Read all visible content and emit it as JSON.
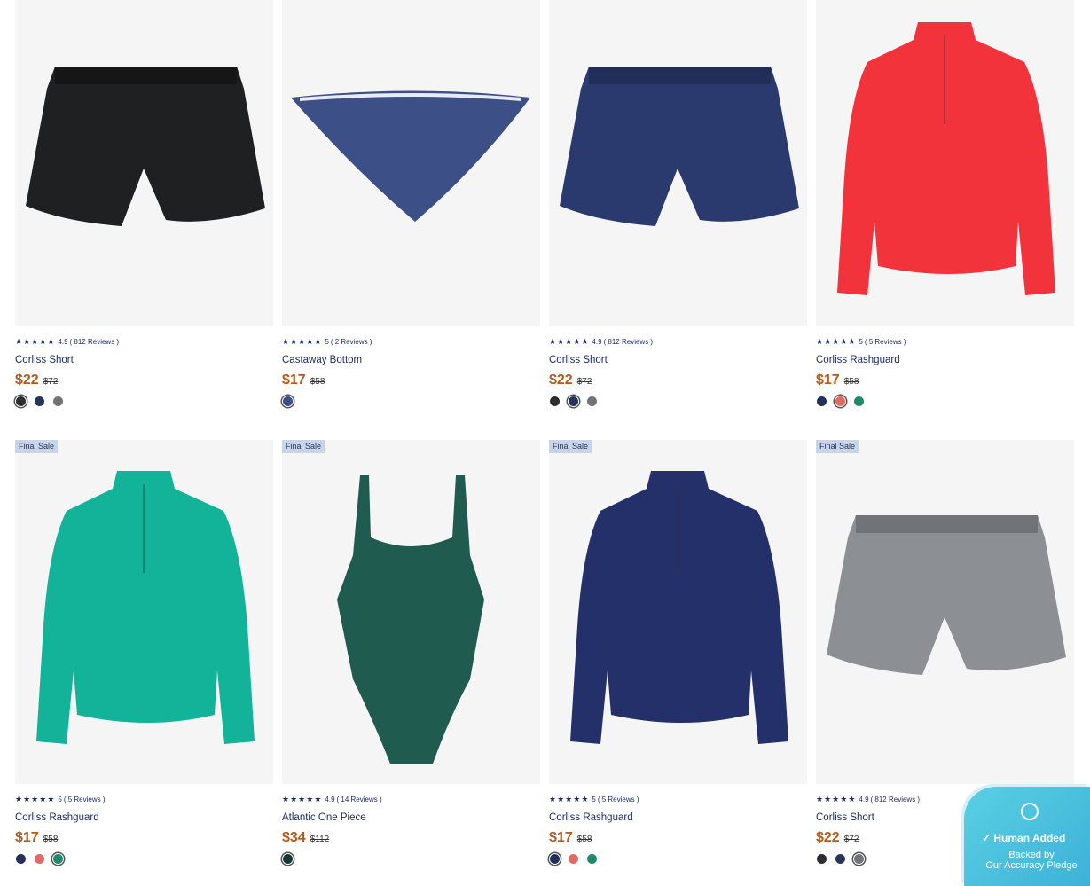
{
  "products": [
    {
      "badge": "",
      "rating": "4.9",
      "reviews": "( 812 Reviews )",
      "title": "Corliss Short",
      "price": "$22",
      "old": "$72",
      "swatches": [
        {
          "c": "#2b2d30",
          "sel": true
        },
        {
          "c": "#27355a",
          "sel": false
        },
        {
          "c": "#717476",
          "sel": false
        }
      ],
      "img": "shorts-black"
    },
    {
      "badge": "",
      "rating": "5",
      "reviews": "( 2 Reviews )",
      "title": "Castaway Bottom",
      "price": "$17",
      "old": "$58",
      "swatches": [
        {
          "c": "#3c4f86",
          "sel": true
        }
      ],
      "img": "bikini"
    },
    {
      "badge": "",
      "rating": "4.9",
      "reviews": "( 812 Reviews )",
      "title": "Corliss Short",
      "price": "$22",
      "old": "$72",
      "swatches": [
        {
          "c": "#2b2d30",
          "sel": false
        },
        {
          "c": "#27355a",
          "sel": true
        },
        {
          "c": "#717476",
          "sel": false
        }
      ],
      "img": "shorts-navy"
    },
    {
      "badge": "",
      "rating": "5",
      "reviews": "( 5 Reviews )",
      "title": "Corliss Rashguard",
      "price": "$17",
      "old": "$58",
      "swatches": [
        {
          "c": "#22305a",
          "sel": false
        },
        {
          "c": "#e06b63",
          "sel": true
        },
        {
          "c": "#1e8a6b",
          "sel": false
        }
      ],
      "img": "rash-red"
    },
    {
      "badge": "Final Sale",
      "rating": "5",
      "reviews": "( 5 Reviews )",
      "title": "Corliss Rashguard",
      "price": "$17",
      "old": "$58",
      "swatches": [
        {
          "c": "#22305a",
          "sel": false
        },
        {
          "c": "#e06b63",
          "sel": false
        },
        {
          "c": "#1e8a6b",
          "sel": true
        }
      ],
      "img": "rash-teal"
    },
    {
      "badge": "Final Sale",
      "rating": "4.9",
      "reviews": "( 14 Reviews )",
      "title": "Atlantic One Piece",
      "price": "$34",
      "old": "$112",
      "swatches": [
        {
          "c": "#123a35",
          "sel": true
        }
      ],
      "img": "onepiece"
    },
    {
      "badge": "Final Sale",
      "rating": "5",
      "reviews": "( 5 Reviews )",
      "title": "Corliss Rashguard",
      "price": "$17",
      "old": "$58",
      "swatches": [
        {
          "c": "#22305a",
          "sel": true
        },
        {
          "c": "#e06b63",
          "sel": false
        },
        {
          "c": "#1e8a6b",
          "sel": false
        }
      ],
      "img": "rash-navy"
    },
    {
      "badge": "Final Sale",
      "rating": "4.9",
      "reviews": "( 812 Reviews )",
      "title": "Corliss Short",
      "price": "$22",
      "old": "$72",
      "swatches": [
        {
          "c": "#2b2d30",
          "sel": false
        },
        {
          "c": "#27355a",
          "sel": false
        },
        {
          "c": "#717476",
          "sel": true
        }
      ],
      "img": "shorts-grey"
    }
  ],
  "pledge": {
    "heading": "Human Added",
    "line1": "Backed by",
    "line2": "Our Accuracy Pledge"
  }
}
